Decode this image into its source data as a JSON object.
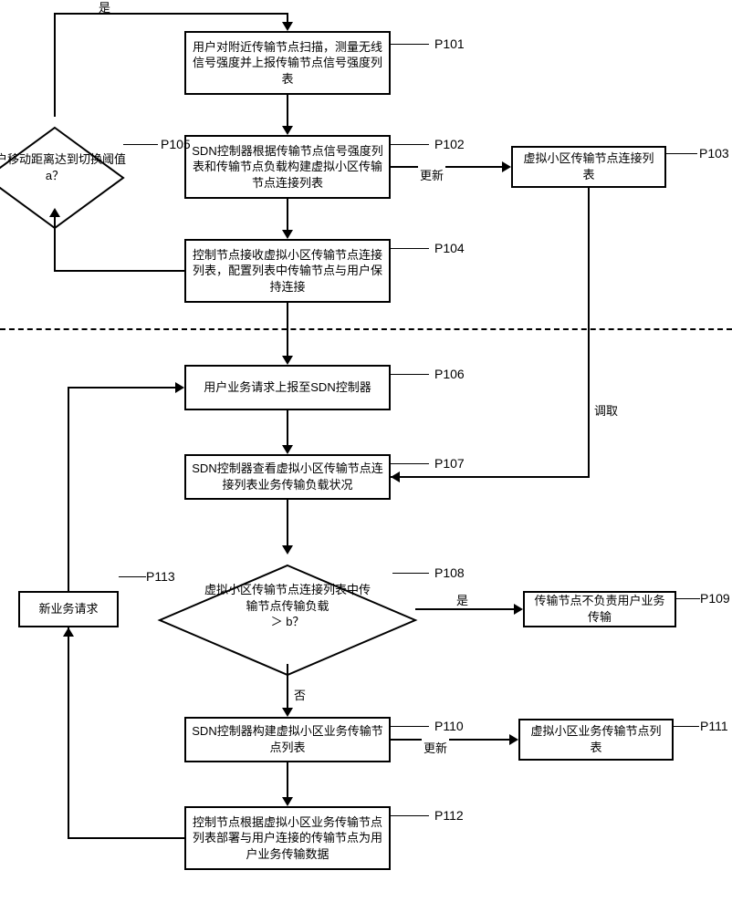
{
  "nodes": {
    "p101": {
      "label": "P101",
      "text": "用户对附近传输节点扫描，测量无线信号强度并上报传输节点信号强度列表"
    },
    "p102": {
      "label": "P102",
      "text": "SDN控制器根据传输节点信号强度列表和传输节点负载构建虚拟小区传输节点连接列表"
    },
    "p103": {
      "label": "P103",
      "text": "虚拟小区传输节点连接列表"
    },
    "p104": {
      "label": "P104",
      "text": "控制节点接收虚拟小区传输节点连接列表，配置列表中传输节点与用户保持连接"
    },
    "p105": {
      "label": "P105",
      "text": "用户移动距离达到切换阈值a？"
    },
    "p106": {
      "label": "P106",
      "text": "用户业务请求上报至SDN控制器"
    },
    "p107": {
      "label": "P107",
      "text": "SDN控制器查看虚拟小区传输节点连接列表业务传输负载状况"
    },
    "p108": {
      "label": "P108",
      "text": "虚拟小区传输节点连接列表中传输节点传输负载\n＞ b？"
    },
    "p109": {
      "label": "P109",
      "text": "传输节点不负责用户业务传输"
    },
    "p110": {
      "label": "P110",
      "text": "SDN控制器构建虚拟小区业务传输节点列表"
    },
    "p111": {
      "label": "P111",
      "text": "虚拟小区业务传输节点列表"
    },
    "p112": {
      "label": "P112",
      "text": "控制节点根据虚拟小区业务传输节点列表部署与用户连接的传输节点为用户业务传输数据"
    },
    "p113": {
      "label": "P113",
      "text": "新业务请求"
    }
  },
  "edges": {
    "yes_top": "是",
    "update1": "更新",
    "update2": "更新",
    "retrieve": "调取",
    "yes_mid": "是",
    "no_mid": "否"
  }
}
